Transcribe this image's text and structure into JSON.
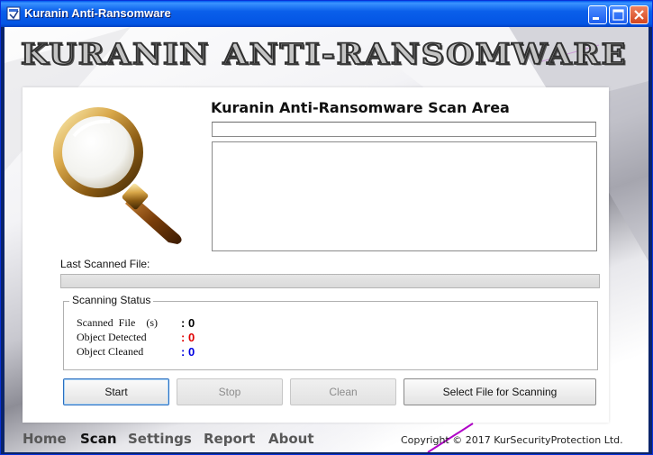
{
  "window": {
    "title": "Kuranin Anti-Ransomware"
  },
  "banner": {
    "text": "KURANIN ANTI-RANSOMWARE"
  },
  "scan": {
    "title": "Kuranin Anti-Ransomware Scan Area",
    "path_value": "",
    "log_value": "",
    "last_scanned_label": "Last Scanned File:",
    "progress": 0
  },
  "status": {
    "legend": "Scanning Status",
    "rows": [
      {
        "label": "Scanned  File    (s)",
        "value": ": 0",
        "color": "#000000"
      },
      {
        "label": "Object Detected",
        "value": ": 0",
        "color": "#e00000"
      },
      {
        "label": "Object Cleaned",
        "value": ": 0",
        "color": "#0000e0"
      }
    ]
  },
  "buttons": {
    "start": "Start",
    "stop": "Stop",
    "clean": "Clean",
    "select_file": "Select File for Scanning"
  },
  "nav": {
    "items": [
      "Home",
      "Scan",
      "Settings",
      "Report",
      "About"
    ],
    "active": "Scan"
  },
  "footer": {
    "copyright": "Copyright © 2017 KurSecurityProtection Ltd."
  },
  "colors": {
    "titlebar": "#0355e4",
    "detected": "#e00000",
    "cleaned": "#0000e0"
  },
  "icons": {
    "app": "app-window-icon",
    "magnifier": "magnifying-glass-icon",
    "minimize": "minimize-icon",
    "maximize": "maximize-icon",
    "close": "close-icon"
  }
}
